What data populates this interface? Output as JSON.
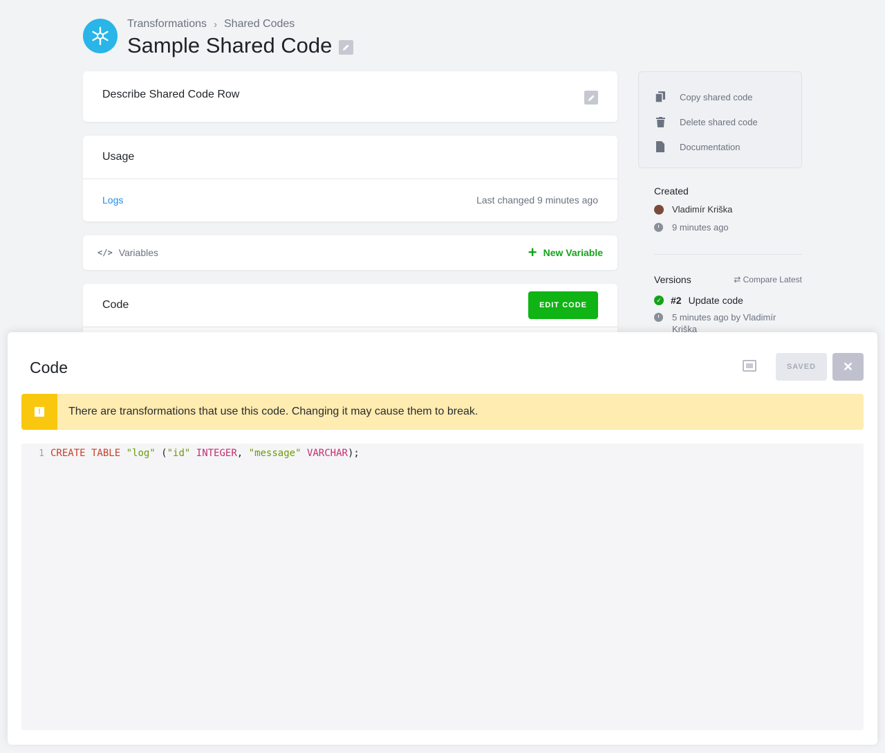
{
  "header": {
    "breadcrumb": [
      "Transformations",
      "Shared Codes"
    ],
    "title": "Sample Shared Code"
  },
  "describe": {
    "label": "Describe Shared Code Row"
  },
  "usage": {
    "title": "Usage",
    "logs_link": "Logs",
    "last_changed": "Last changed 9 minutes ago"
  },
  "variables": {
    "label": "Variables",
    "new_button": "New Variable"
  },
  "code_card": {
    "title": "Code",
    "edit_button": "EDIT CODE"
  },
  "sidebar": {
    "actions": [
      {
        "label": "Copy shared code",
        "icon": "copy-icon"
      },
      {
        "label": "Delete shared code",
        "icon": "trash-icon"
      },
      {
        "label": "Documentation",
        "icon": "document-icon"
      }
    ],
    "created": {
      "title": "Created",
      "author": "Vladimír Kriška",
      "time": "9 minutes ago"
    },
    "versions": {
      "title": "Versions",
      "compare": "⇄ Compare Latest",
      "latest_number": "#2",
      "latest_desc": "Update code",
      "latest_meta": "5 minutes ago by Vladimír Kriška"
    }
  },
  "modal": {
    "title": "Code",
    "saved_button": "SAVED",
    "close_button": "✕",
    "alert": "There are transformations that use this code. Changing it may cause them to break.",
    "editor": {
      "line_number": "1",
      "tokens": [
        "CREATE TABLE",
        " ",
        "\"log\"",
        " (",
        "\"id\"",
        " ",
        "INTEGER",
        ", ",
        "\"message\"",
        " ",
        "VARCHAR",
        ");"
      ]
    }
  },
  "colors": {
    "accent_green": "#10b414",
    "link_blue": "#1f8ceb",
    "warning_yellow": "#f9c80e",
    "snowflake_blue": "#29b5e8"
  }
}
